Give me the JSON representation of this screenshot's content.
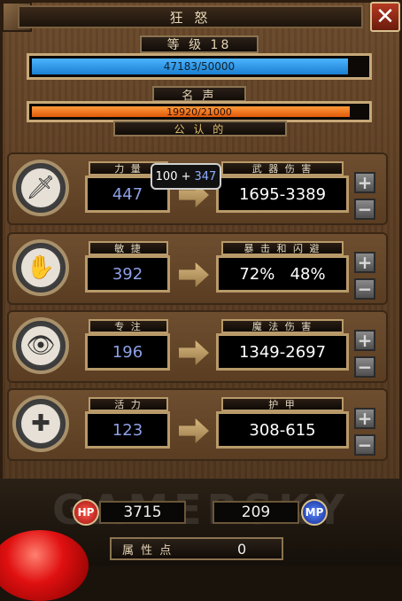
{
  "window": {
    "title": "狂 怒",
    "close_label": "✕"
  },
  "level": {
    "label": "等 级 18",
    "current": 47183,
    "max": 50000,
    "text": "47183/50000",
    "color": "#1c8fe0"
  },
  "fame": {
    "label": "名 声",
    "current": 19920,
    "max": 21000,
    "text": "19920/21000",
    "color": "#f06a14",
    "rank": "公 认 的"
  },
  "tooltip": {
    "base": "100 +",
    "bonus": "347"
  },
  "stats": [
    {
      "name": "力 量",
      "value": "447",
      "result_label": "武 器 伤 害",
      "result": "1695-3389",
      "icon": "sword-icon",
      "glyph": "🗡"
    },
    {
      "name": "敏 捷",
      "value": "392",
      "result_label": "暴 击 和 闪 避",
      "result": "72%   48%",
      "icon": "dodge-hand-icon",
      "glyph": "✋"
    },
    {
      "name": "专 注",
      "value": "196",
      "result_label": "魔 法 伤 害",
      "result": "1349-2697",
      "icon": "eye-flame-icon",
      "glyph": "👁"
    },
    {
      "name": "活 力",
      "value": "123",
      "result_label": "护 甲",
      "result": "308-615",
      "icon": "shield-cross-icon",
      "glyph": "✚"
    }
  ],
  "bottom": {
    "hp_label": "HP",
    "hp_value": "3715",
    "mp_label": "MP",
    "mp_value": "209",
    "points_label": "属 性 点",
    "points_value": "0",
    "watermark": "GAMERSKY"
  },
  "colors": {
    "hp_orb": "#c8201a",
    "mp_orb": "#2040b0",
    "stat_value": "#8ea0e6"
  }
}
